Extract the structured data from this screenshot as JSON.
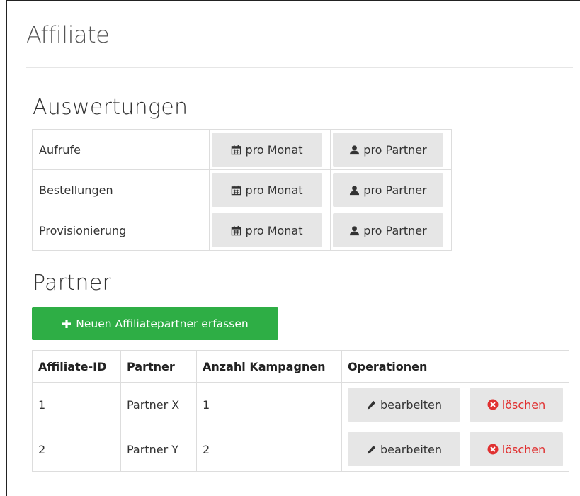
{
  "page": {
    "title": "Affiliate"
  },
  "evaluations": {
    "heading": "Auswertungen",
    "rows": [
      {
        "label": "Aufrufe",
        "month_label": "pro Monat",
        "partner_label": "pro Partner"
      },
      {
        "label": "Bestellungen",
        "month_label": "pro Monat",
        "partner_label": "pro Partner"
      },
      {
        "label": "Provisionierung",
        "month_label": "pro Monat",
        "partner_label": "pro Partner"
      }
    ]
  },
  "partners": {
    "heading": "Partner",
    "add_button_label": "Neuen Affiliatepartner erfassen",
    "columns": [
      "Affiliate-ID",
      "Partner",
      "Anzahl Kampagnen",
      "Operationen"
    ],
    "rows": [
      {
        "id": "1",
        "name": "Partner X",
        "campaigns": "1",
        "edit_label": "bearbeiten",
        "delete_label": "löschen"
      },
      {
        "id": "2",
        "name": "Partner Y",
        "campaigns": "2",
        "edit_label": "bearbeiten",
        "delete_label": "löschen"
      }
    ]
  },
  "colors": {
    "add_button": "#2eae45",
    "delete_text": "#e03131",
    "button_gray": "#e6e6e6"
  },
  "icons": {
    "month": "calendar-icon",
    "partner": "user-icon",
    "add": "plus-icon",
    "edit": "pencil-icon",
    "delete": "times-circle-icon"
  }
}
